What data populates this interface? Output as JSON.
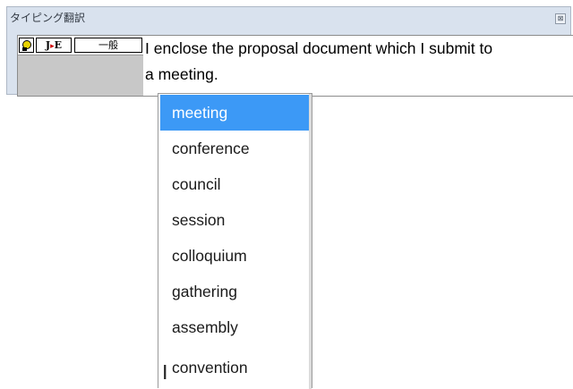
{
  "window": {
    "title": "タイピング翻訳",
    "close_glyph": "⊠"
  },
  "toolbar": {
    "je_left": "J",
    "je_arrow": "▸",
    "je_right": "E",
    "category": "一般"
  },
  "translation": {
    "line1": "I enclose the proposal document which I submit to",
    "line2": "a meeting."
  },
  "dropdown": {
    "items": [
      "meeting",
      "conference",
      "council",
      "session",
      "colloquium",
      "gathering",
      "assembly",
      "convention"
    ],
    "selected": "meeting"
  },
  "colors": {
    "selection": "#3c99f6",
    "window_bg": "#d9e2ee"
  }
}
